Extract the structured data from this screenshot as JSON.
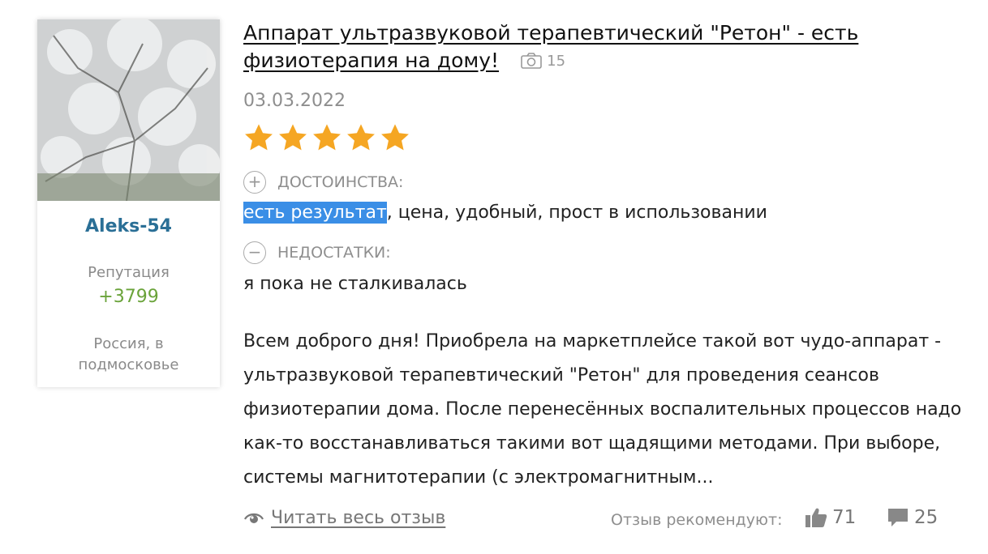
{
  "author": {
    "name": "Aleks-54",
    "reputation_label": "Репутация",
    "reputation_value": "+3799",
    "location": "Россия, в подмосковье"
  },
  "review": {
    "title": "Аппарат ультразвуковой терапевтический \"Ретон\" - есть физиотерапия на дому!",
    "photo_count": "15",
    "date": "03.03.2022",
    "rating": 5,
    "pros_label": "ДОСТОИНСТВА:",
    "pros_highlight": "есть результат",
    "pros_rest": ", цена, удобный, прост в использовании",
    "cons_label": "НЕДОСТАТКИ:",
    "cons_text": "я пока не сталкивалась",
    "body": "Всем доброго дня! Приобрела на маркетплейсе такой вот чудо-аппарат - ультразвуковой терапевтический \"Ретон\" для проведения сеансов физиотерапии дома. После перенесённых воспалительных процессов надо как-то восстанавливаться такими вот щадящими методами. При выборе, системы магнитотерапии (с электромагнитным...",
    "read_more": "Читать весь отзыв",
    "recommend_label": "Отзыв рекомендуют:",
    "likes": "71",
    "comments": "25"
  },
  "icons": {
    "camera": "camera-icon",
    "plus": "plus-circle-icon",
    "minus": "minus-circle-icon",
    "eye": "eye-icon",
    "thumb": "thumbs-up-icon",
    "comment": "comment-icon"
  },
  "colors": {
    "author_name": "#2a6f96",
    "reputation": "#6aa33a",
    "star": "#f5a623",
    "highlight": "#3a8ee6"
  }
}
